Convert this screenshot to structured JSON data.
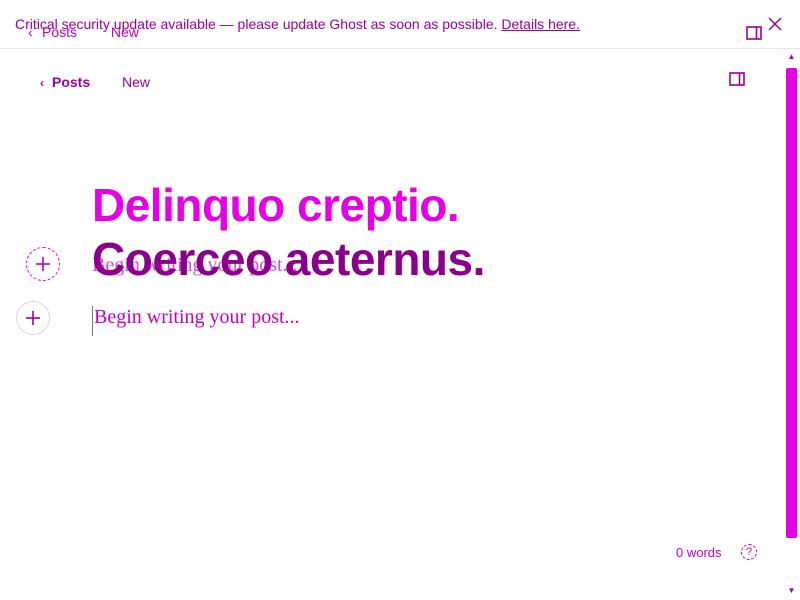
{
  "banner": {
    "message": "Critical security update available — please update Ghost as soon as possible.",
    "link_label": "Details here.",
    "close_icon": "close-icon"
  },
  "ghost_nav": {
    "back_label": "Posts",
    "status_label": "New"
  },
  "nav": {
    "back_label": "Posts",
    "status_label": "New",
    "settings_icon": "sidebar-toggle-icon"
  },
  "post": {
    "title_line1": "Delinquo creptio.",
    "title_line2": "Coerceo aeternus.",
    "body_placeholder": "Begin writing your post...",
    "ghost_placeholder": "Begin writing your post..."
  },
  "footer": {
    "word_count": "0 words",
    "help_label": "?"
  },
  "colors": {
    "accent": "#e600e6",
    "text": "#9b009b",
    "title_dark": "#8a008a"
  }
}
